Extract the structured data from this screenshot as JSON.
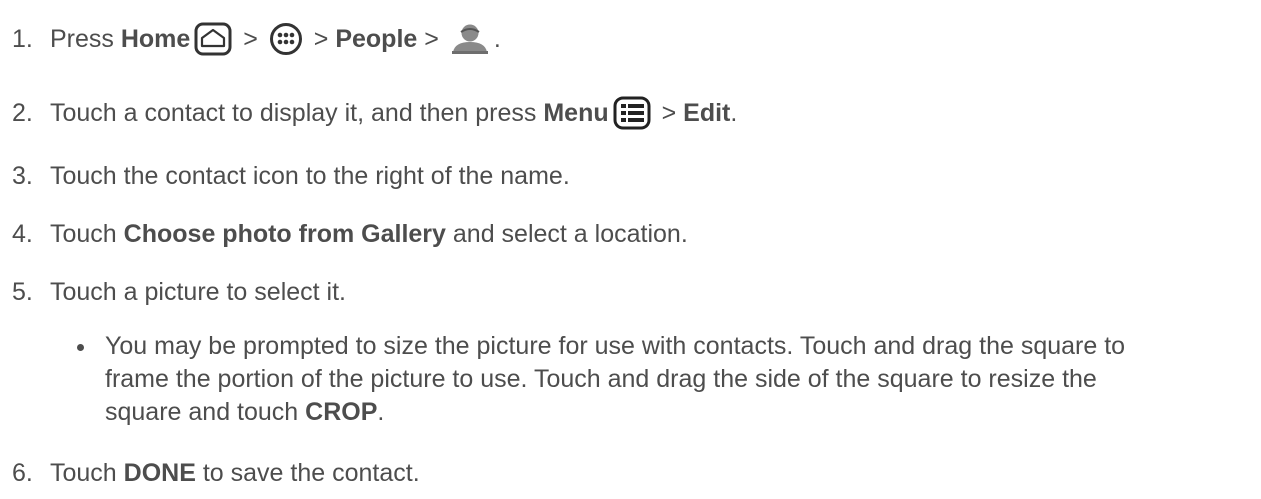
{
  "steps": [
    {
      "num": "1.",
      "t1": "Press ",
      "b1": "Home",
      "sep1": " > ",
      "sep2": " > ",
      "b2": "People",
      "sep3": " > ",
      "end": ".",
      "icons": [
        "home-icon",
        "apps-icon",
        "person-icon"
      ]
    },
    {
      "num": "2.",
      "t1": "Touch a contact to display it, and then press ",
      "b1": "Menu",
      "sep1": " > ",
      "b2": "Edit",
      "end": ".",
      "icons": [
        "menu-icon"
      ]
    },
    {
      "num": "3.",
      "t1": "Touch the contact icon to the right of the name."
    },
    {
      "num": "4.",
      "t1": "Touch ",
      "b1": "Choose photo from Gallery",
      "t2": " and select a location."
    },
    {
      "num": "5.",
      "t1": "Touch a picture to select it."
    },
    {
      "num": "6.",
      "t1": "Touch ",
      "b1": "DONE",
      "t2": " to save the contact."
    }
  ],
  "bullet": {
    "line1": "You may be prompted to size the picture for use with contacts. Touch and drag the square to",
    "line2": "frame the portion of the picture to use. Touch and drag the side of the square to resize the",
    "line3a": "square and touch ",
    "line3b": "CROP",
    "line3c": "."
  },
  "colors": {
    "text": "#4d4d4d",
    "icon": "#333333"
  }
}
